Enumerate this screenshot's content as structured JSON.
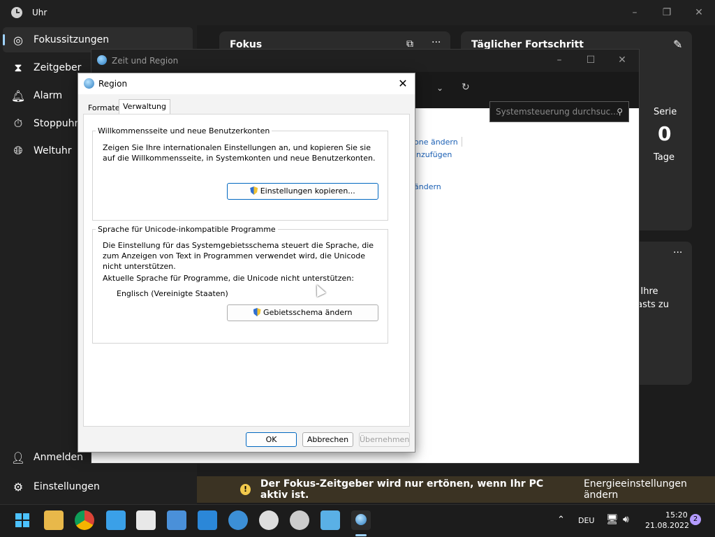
{
  "app": {
    "title": "Uhr",
    "nav": [
      {
        "label": "Fokussitzungen",
        "icon": "focus-icon"
      },
      {
        "label": "Zeitgeber",
        "icon": "hourglass-icon"
      },
      {
        "label": "Alarm",
        "icon": "bell-icon"
      },
      {
        "label": "Stoppuhr",
        "icon": "stopwatch-icon"
      },
      {
        "label": "Weltuhr",
        "icon": "globe-icon"
      }
    ],
    "bottom_nav": [
      {
        "label": "Anmelden",
        "icon": "person-icon"
      },
      {
        "label": "Einstellungen",
        "icon": "gear-icon"
      }
    ],
    "focus_card_title": "Fokus",
    "progress_card_title": "Täglicher Fortschritt",
    "streak_label": "Serie",
    "streak_value": "0",
    "streak_unit": "Tage",
    "partial_text_1": "n Ihre",
    "partial_text_2": "casts zu",
    "notification_text": "Der Fokus-Zeitgeber wird nur ertönen, wenn Ihr PC aktiv ist.",
    "notification_link": "Energieeinstellungen ändern"
  },
  "zeit_region": {
    "title": "Zeit und Region",
    "search_placeholder": "Systemsteuerung durchsuc...",
    "links": [
      "one ändern",
      "inzufügen",
      "ändern"
    ]
  },
  "region": {
    "title": "Region",
    "tabs": [
      "Formate",
      "Verwaltung"
    ],
    "active_tab": "Verwaltung",
    "group1_title": "Willkommensseite und neue Benutzerkonten",
    "group1_text": "Zeigen Sie Ihre internationalen Einstellungen an, und kopieren Sie sie auf die Willkommensseite, in Systemkonten und neue Benutzerkonten.",
    "copy_button": "Einstellungen kopieren...",
    "group2_title": "Sprache für Unicode-inkompatible Programme",
    "group2_text": "Die Einstellung für das Systemgebietsschema steuert die Sprache, die zum Anzeigen von Text in Programmen verwendet wird, die Unicode nicht unterstützen.",
    "current_label": "Aktuelle Sprache für Programme, die Unicode nicht unterstützen:",
    "current_value": "Englisch (Vereinigte Staaten)",
    "change_button": "Gebietsschema ändern",
    "ok": "OK",
    "cancel": "Abbrechen",
    "apply": "Übernehmen"
  },
  "taskbar": {
    "language": "DEU",
    "time": "15:20",
    "date": "21.08.2022",
    "notification_count": "2"
  },
  "colors": {
    "accent": "#9fd3ff",
    "link": "#1a5fb4",
    "warning": "#f2c94c"
  }
}
